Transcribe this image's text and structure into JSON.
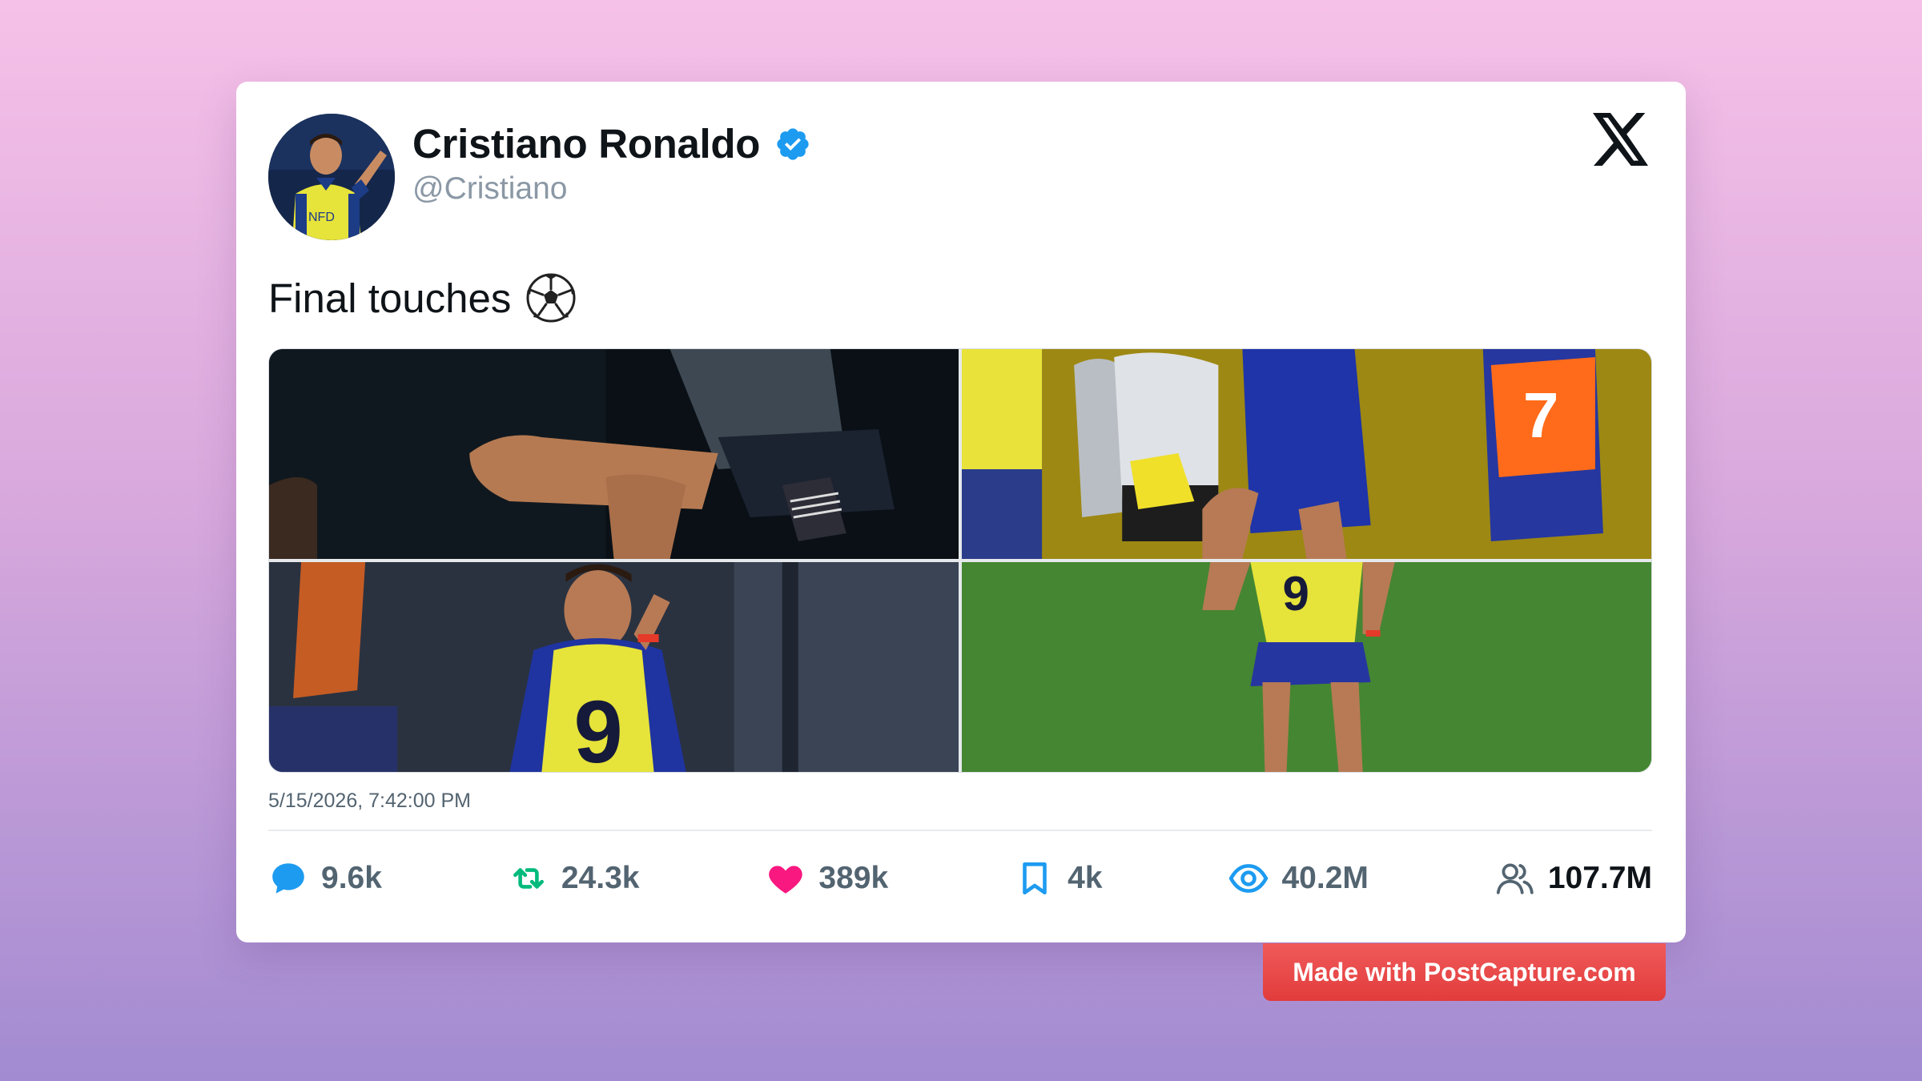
{
  "profile": {
    "name": "Cristiano Ronaldo",
    "handle": "@Cristiano",
    "verified": true,
    "avatar_icon": "profile-photo"
  },
  "platform_icon": "x-logo",
  "tweet": {
    "text": "Final touches",
    "emoji_icon": "soccer-ball",
    "timestamp": "5/15/2026, 7:42:00 PM",
    "images": [
      {
        "name": "photo-legs-closeup"
      },
      {
        "name": "photo-team-training"
      },
      {
        "name": "photo-number-nine-bib"
      },
      {
        "name": "photo-on-pitch"
      }
    ]
  },
  "stats": {
    "replies": "9.6k",
    "retweets": "24.3k",
    "likes": "389k",
    "bookmarks": "4k",
    "views": "40.2M",
    "followers": "107.7M"
  },
  "colors": {
    "reply": "#1d9bf0",
    "retweet": "#00ba7c",
    "like": "#f91880",
    "bookmark": "#1d9bf0",
    "views": "#1d9bf0",
    "followers": "#536471",
    "verified": "#1d9bf0",
    "watermark": "#e23c3c"
  },
  "watermark": "Made with PostCapture.com"
}
